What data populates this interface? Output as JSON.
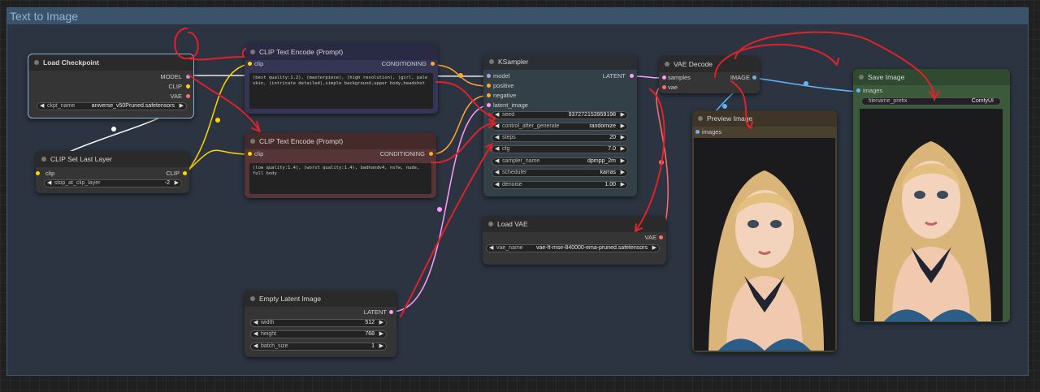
{
  "group": {
    "title": "Text to Image"
  },
  "nodes": {
    "load_checkpoint": {
      "title": "Load Checkpoint",
      "outputs": [
        "MODEL",
        "CLIP",
        "VAE"
      ],
      "ckpt": {
        "label": "ckpt_name",
        "value": "aniverse_v50Pruned.safetensors"
      }
    },
    "clip_set_last_layer": {
      "title": "CLIP Set Last Layer",
      "input": "clip",
      "output": "CLIP",
      "stop": {
        "label": "stop_at_clip_layer",
        "value": "-2"
      }
    },
    "clip_pos": {
      "title": "CLIP Text Encode (Prompt)",
      "input": "clip",
      "output": "CONDITIONING",
      "text": "(best quality:1.2), (masterpiece), (high resolution), (girl, pale skin, (intricate detailed),simple background,upper body,headshot"
    },
    "clip_neg": {
      "title": "CLIP Text Encode (Prompt)",
      "input": "clip",
      "output": "CONDITIONING",
      "text": "(low quality:1.4), (worst quality:1.4), badhandv4, nsfw, nude, full body"
    },
    "ksampler": {
      "title": "KSampler",
      "inputs": [
        "model",
        "positive",
        "negative",
        "latent_image"
      ],
      "output": "LATENT",
      "widgets": [
        {
          "label": "seed",
          "value": "937272153959198"
        },
        {
          "label": "control_after_generate",
          "value": "randomize"
        },
        {
          "label": "steps",
          "value": "20"
        },
        {
          "label": "cfg",
          "value": "7.0"
        },
        {
          "label": "sampler_name",
          "value": "dpmpp_2m"
        },
        {
          "label": "scheduler",
          "value": "karras"
        },
        {
          "label": "denoise",
          "value": "1.00"
        }
      ]
    },
    "vae_decode": {
      "title": "VAE Decode",
      "inputs": [
        "samples",
        "vae"
      ],
      "output": "IMAGE"
    },
    "load_vae": {
      "title": "Load VAE",
      "output": "VAE",
      "vae": {
        "label": "vae_name",
        "value": "vae-ft-mse-840000-ema-pruned.safetensors"
      }
    },
    "empty_latent": {
      "title": "Empty Latent Image",
      "output": "LATENT",
      "widgets": [
        {
          "label": "width",
          "value": "512"
        },
        {
          "label": "height",
          "value": "768"
        },
        {
          "label": "batch_size",
          "value": "1"
        }
      ]
    },
    "preview_image": {
      "title": "Preview Image",
      "input": "images"
    },
    "save_image": {
      "title": "Save Image",
      "input": "images",
      "prefix": {
        "label": "filename_prefix",
        "value": "ComfyUI"
      }
    }
  },
  "colors": {
    "model_pin": "#b39ddb",
    "clip_pin": "#ffd500",
    "vae_pin": "#ff6e6e",
    "conditioning_pin": "#ffa931",
    "latent_pin": "#ff9cf9",
    "image_pin": "#64b5f6",
    "annotation": "#e0222a"
  }
}
